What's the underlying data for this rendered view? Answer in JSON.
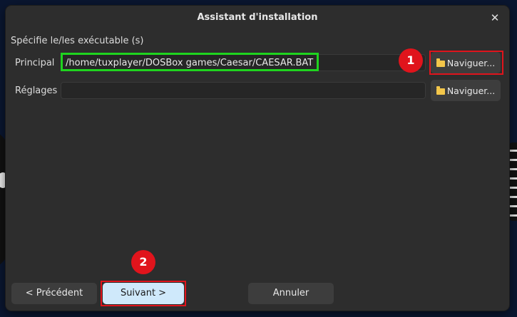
{
  "window": {
    "title": "Assistant d'installation",
    "close_glyph": "✕"
  },
  "section": {
    "label": "Spécifie le/les exécutable (s)"
  },
  "rows": [
    {
      "label": "Principal",
      "value": "/home/tuxplayer/DOSBox games/Caesar/CAESAR.BAT",
      "browse_label": "Naviguer..."
    },
    {
      "label": "Réglages",
      "value": "",
      "browse_label": "Naviguer..."
    }
  ],
  "annotations": {
    "badge_1": "1",
    "badge_2": "2",
    "highlight_green": "#1fd41f",
    "highlight_red": "#e0141c"
  },
  "footer": {
    "previous_label": "< Précédent",
    "next_label": "Suivant >",
    "cancel_label": "Annuler"
  },
  "icons": {
    "folder": "folder-icon",
    "close": "close-icon"
  }
}
